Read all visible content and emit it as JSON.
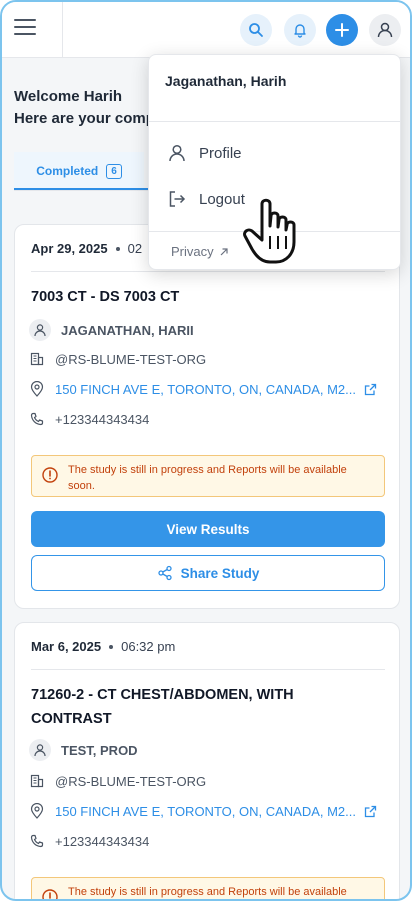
{
  "topbar": {
    "icons": [
      "menu-icon",
      "search-icon",
      "bell-icon",
      "plus-icon",
      "user-icon"
    ]
  },
  "welcome": {
    "line1": "Welcome Harih",
    "line2": "Here are your comp"
  },
  "tabs": [
    {
      "label": "Completed",
      "count": "6"
    }
  ],
  "menu": {
    "user_name": "Jaganathan, Harih",
    "items": [
      {
        "label": "Profile",
        "icon": "user-icon"
      },
      {
        "label": "Logout",
        "icon": "logout-icon"
      }
    ],
    "footer_links": [
      "Privacy",
      ""
    ]
  },
  "cards": [
    {
      "date": "Apr 29, 2025",
      "time": "02",
      "title": "7003 CT - DS 7003 CT",
      "patient": "JAGANATHAN, HARII",
      "org": "@RS-BLUME-TEST-ORG",
      "address": "150 FINCH AVE E, TORONTO, ON, CANADA, M2...",
      "phone": "+123344343434",
      "alert": "The study is still in progress and Reports will be available soon.",
      "primary_button": "View Results",
      "secondary_button": "Share Study"
    },
    {
      "date": "Mar 6, 2025",
      "time": "06:32 pm",
      "title": "71260-2 - CT CHEST/ABDOMEN, WITH CONTRAST",
      "patient": "TEST, PROD",
      "org": "@RS-BLUME-TEST-ORG",
      "address": "150 FINCH AVE E, TORONTO, ON, CANADA, M2...",
      "phone": "+123344343434",
      "alert": "The study is still in progress and Reports will be available"
    }
  ],
  "colors": {
    "accent": "#2d8ee6",
    "alert_bg": "#fff8e6",
    "alert_text": "#c2410c",
    "frame_border": "#7cc4ee"
  }
}
